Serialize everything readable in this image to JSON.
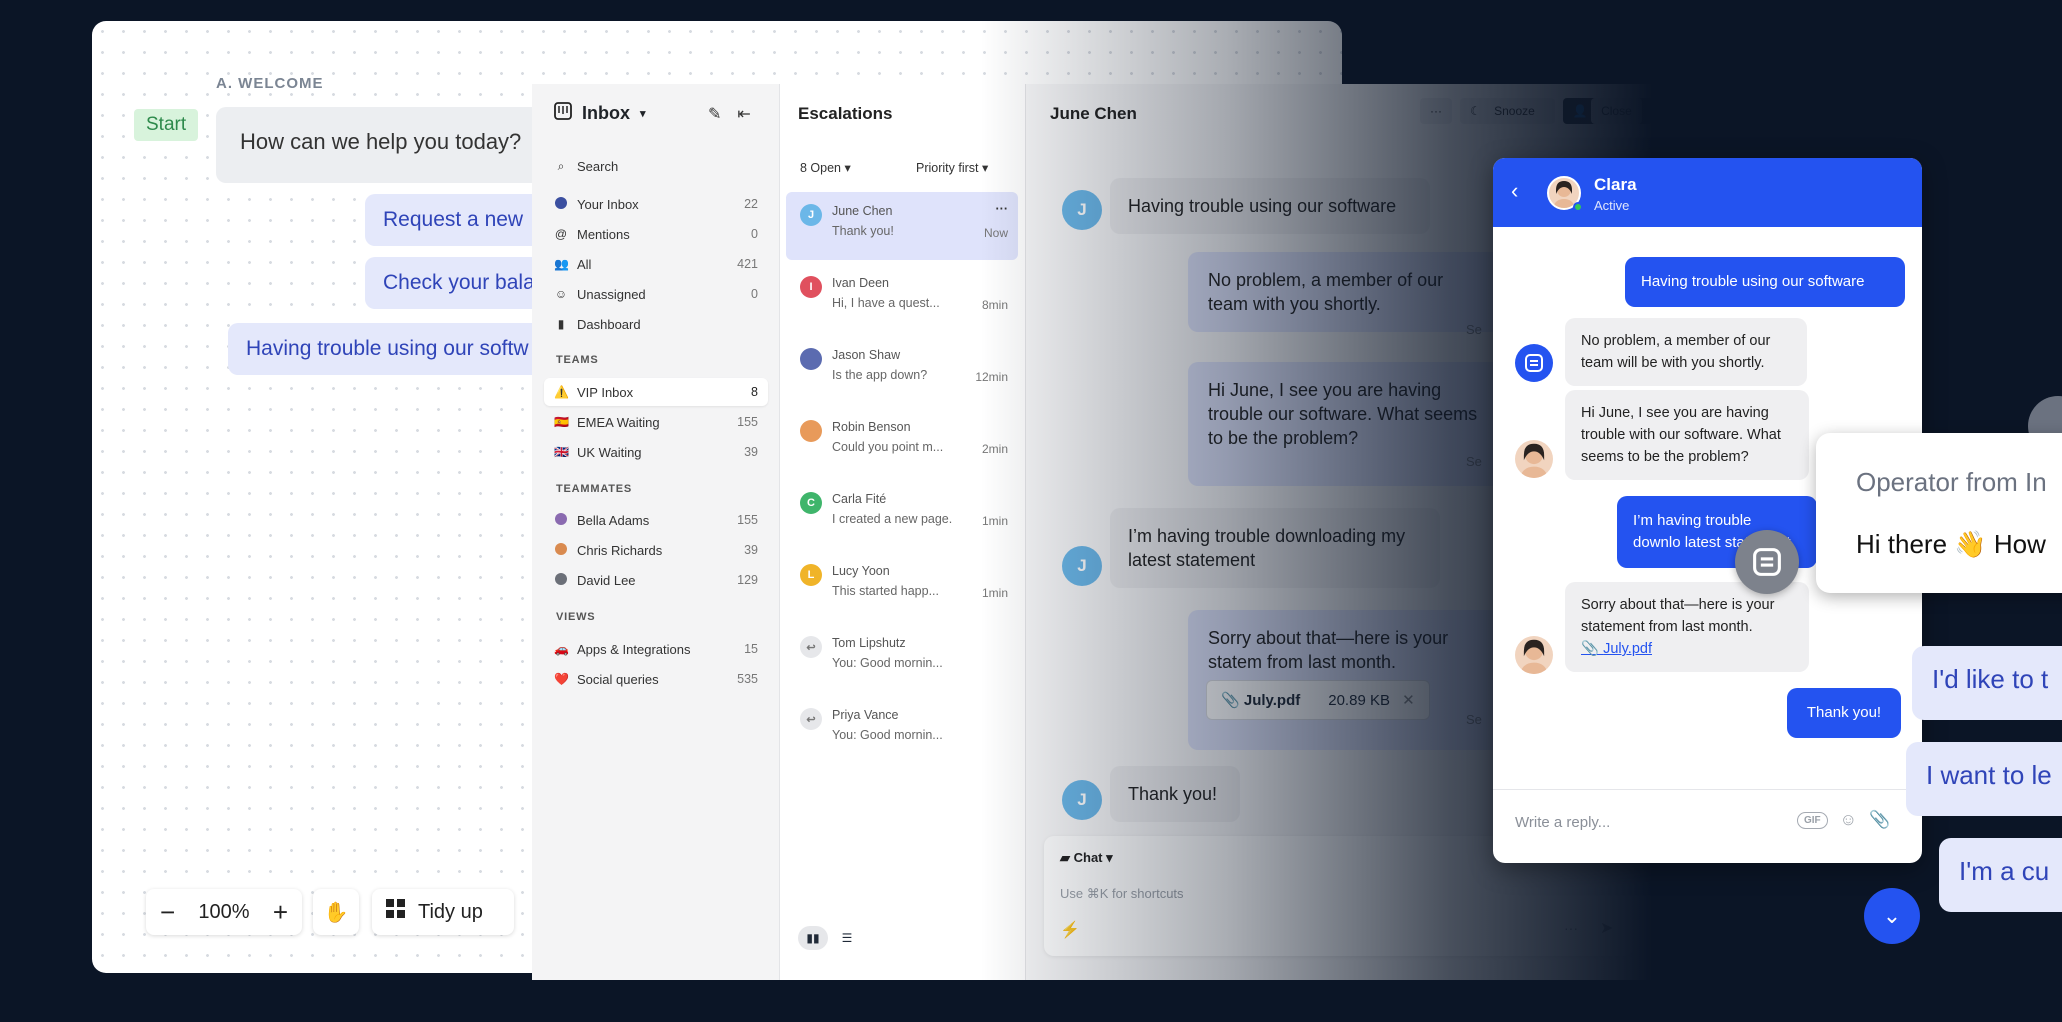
{
  "flow": {
    "section_label": "A. WELCOME",
    "start_badge": "Start",
    "welcome_message": "How can we help you today?",
    "options": [
      "Request a new",
      "Check your bala",
      "Having trouble using our softw"
    ],
    "zoom": {
      "minus": "−",
      "level": "100%",
      "plus": "+"
    },
    "tidy_label": "Tidy up"
  },
  "inbox": {
    "title": "Inbox",
    "search_label": "Search",
    "nav": [
      {
        "label": "Your Inbox",
        "count": "22"
      },
      {
        "label": "Mentions",
        "count": "0"
      },
      {
        "label": "All",
        "count": "421"
      },
      {
        "label": "Unassigned",
        "count": "0"
      },
      {
        "label": "Dashboard",
        "count": ""
      }
    ],
    "teams_header": "TEAMS",
    "teams": [
      {
        "label": "VIP Inbox",
        "count": "8"
      },
      {
        "label": "EMEA Waiting",
        "count": "155"
      },
      {
        "label": "UK Waiting",
        "count": "39"
      }
    ],
    "teammates_header": "TEAMMATES",
    "teammates": [
      {
        "label": "Bella Adams",
        "count": "155"
      },
      {
        "label": "Chris Richards",
        "count": "39"
      },
      {
        "label": "David Lee",
        "count": "129"
      }
    ],
    "views_header": "VIEWS",
    "views": [
      {
        "label": "Apps & Integrations",
        "count": "15"
      },
      {
        "label": "Social queries",
        "count": "535"
      }
    ]
  },
  "list": {
    "title": "Escalations",
    "open_filter": "8 Open",
    "sort_filter": "Priority first",
    "conversations": [
      {
        "initial": "J",
        "name": "June Chen",
        "preview": "Thank you!",
        "time": "Now",
        "color": "#6bb7e8"
      },
      {
        "initial": "I",
        "name": "Ivan Deen",
        "preview": "Hi, I have a quest...",
        "time": "8min",
        "color": "#e0505e"
      },
      {
        "initial": "",
        "name": "Jason Shaw",
        "preview": "Is the app down?",
        "time": "12min",
        "color": "#5b6bb0"
      },
      {
        "initial": "",
        "name": "Robin Benson",
        "preview": "Could you point m...",
        "time": "2min",
        "color": "#e89a5a"
      },
      {
        "initial": "C",
        "name": "Carla Fité",
        "preview": "I created a new page...",
        "time": "1min",
        "color": "#3fb56b"
      },
      {
        "initial": "L",
        "name": "Lucy Yoon",
        "preview": "This started happ...",
        "time": "1min",
        "color": "#f0b429"
      },
      {
        "initial": "↩",
        "name": "Tom Lipshutz",
        "preview": "You: Good mornin...",
        "time": "",
        "color": "#c7c9ce"
      },
      {
        "initial": "↩",
        "name": "Priya Vance",
        "preview": "You: Good mornin...",
        "time": "",
        "color": "#c7c9ce"
      }
    ]
  },
  "thread": {
    "title": "June Chen",
    "more": "···",
    "snooze": "Snooze",
    "close": "Close",
    "avatar_initial": "J",
    "msg1": "Having trouble using our software",
    "msg2": "No problem, a member of our team with you shortly.",
    "msg3": "Hi June, I see you are having trouble our software. What seems to be the problem?",
    "msg4": "I’m having trouble downloading my latest statement",
    "msg5": "Sorry about that—here is your statem from last month.",
    "file_name": "July.pdf",
    "file_size": "20.89 KB",
    "msg6": "Thank you!",
    "seen": "Se",
    "composer_mode": "Chat",
    "composer_placeholder": "Use ⌘K for shortcuts"
  },
  "messenger": {
    "agent_name": "Clara",
    "agent_status": "Active",
    "m1": "Having trouble using our software",
    "m2": "No problem, a member of our team will be with you shortly.",
    "m3": "Hi June, I see you are having trouble with our software. What seems to be the problem?",
    "m4": "I’m having trouble downlo latest statement",
    "m5": "Sorry about that—here is your statement from last month.",
    "m5_file": "July.pdf",
    "m6": "Thank you!",
    "reply_placeholder": "Write a reply...",
    "gif": "GIF"
  },
  "operator": {
    "from": "Operator from In",
    "greeting": "Hi there 👋 How"
  },
  "quick_replies": [
    "I'd like to t",
    "I want to le",
    "I'm a cu"
  ],
  "colors": {
    "accent": "#2453f0",
    "background": "#0b1526",
    "flow_option": "#e4e8fb"
  }
}
